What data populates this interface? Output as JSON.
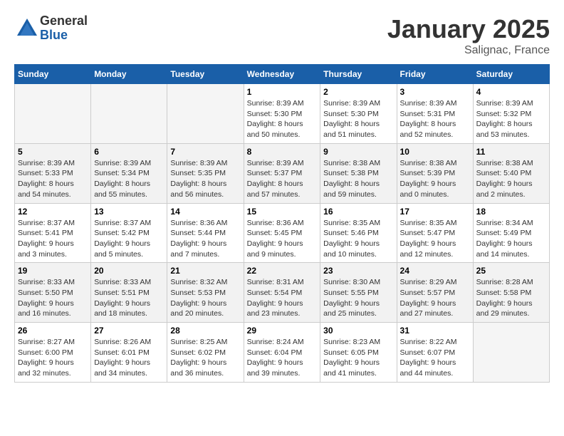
{
  "header": {
    "logo_general": "General",
    "logo_blue": "Blue",
    "month": "January 2025",
    "location": "Salignac, France"
  },
  "days_of_week": [
    "Sunday",
    "Monday",
    "Tuesday",
    "Wednesday",
    "Thursday",
    "Friday",
    "Saturday"
  ],
  "weeks": [
    [
      {
        "day": "",
        "info": ""
      },
      {
        "day": "",
        "info": ""
      },
      {
        "day": "",
        "info": ""
      },
      {
        "day": "1",
        "info": "Sunrise: 8:39 AM\nSunset: 5:30 PM\nDaylight: 8 hours\nand 50 minutes."
      },
      {
        "day": "2",
        "info": "Sunrise: 8:39 AM\nSunset: 5:30 PM\nDaylight: 8 hours\nand 51 minutes."
      },
      {
        "day": "3",
        "info": "Sunrise: 8:39 AM\nSunset: 5:31 PM\nDaylight: 8 hours\nand 52 minutes."
      },
      {
        "day": "4",
        "info": "Sunrise: 8:39 AM\nSunset: 5:32 PM\nDaylight: 8 hours\nand 53 minutes."
      }
    ],
    [
      {
        "day": "5",
        "info": "Sunrise: 8:39 AM\nSunset: 5:33 PM\nDaylight: 8 hours\nand 54 minutes."
      },
      {
        "day": "6",
        "info": "Sunrise: 8:39 AM\nSunset: 5:34 PM\nDaylight: 8 hours\nand 55 minutes."
      },
      {
        "day": "7",
        "info": "Sunrise: 8:39 AM\nSunset: 5:35 PM\nDaylight: 8 hours\nand 56 minutes."
      },
      {
        "day": "8",
        "info": "Sunrise: 8:39 AM\nSunset: 5:37 PM\nDaylight: 8 hours\nand 57 minutes."
      },
      {
        "day": "9",
        "info": "Sunrise: 8:38 AM\nSunset: 5:38 PM\nDaylight: 8 hours\nand 59 minutes."
      },
      {
        "day": "10",
        "info": "Sunrise: 8:38 AM\nSunset: 5:39 PM\nDaylight: 9 hours\nand 0 minutes."
      },
      {
        "day": "11",
        "info": "Sunrise: 8:38 AM\nSunset: 5:40 PM\nDaylight: 9 hours\nand 2 minutes."
      }
    ],
    [
      {
        "day": "12",
        "info": "Sunrise: 8:37 AM\nSunset: 5:41 PM\nDaylight: 9 hours\nand 3 minutes."
      },
      {
        "day": "13",
        "info": "Sunrise: 8:37 AM\nSunset: 5:42 PM\nDaylight: 9 hours\nand 5 minutes."
      },
      {
        "day": "14",
        "info": "Sunrise: 8:36 AM\nSunset: 5:44 PM\nDaylight: 9 hours\nand 7 minutes."
      },
      {
        "day": "15",
        "info": "Sunrise: 8:36 AM\nSunset: 5:45 PM\nDaylight: 9 hours\nand 9 minutes."
      },
      {
        "day": "16",
        "info": "Sunrise: 8:35 AM\nSunset: 5:46 PM\nDaylight: 9 hours\nand 10 minutes."
      },
      {
        "day": "17",
        "info": "Sunrise: 8:35 AM\nSunset: 5:47 PM\nDaylight: 9 hours\nand 12 minutes."
      },
      {
        "day": "18",
        "info": "Sunrise: 8:34 AM\nSunset: 5:49 PM\nDaylight: 9 hours\nand 14 minutes."
      }
    ],
    [
      {
        "day": "19",
        "info": "Sunrise: 8:33 AM\nSunset: 5:50 PM\nDaylight: 9 hours\nand 16 minutes."
      },
      {
        "day": "20",
        "info": "Sunrise: 8:33 AM\nSunset: 5:51 PM\nDaylight: 9 hours\nand 18 minutes."
      },
      {
        "day": "21",
        "info": "Sunrise: 8:32 AM\nSunset: 5:53 PM\nDaylight: 9 hours\nand 20 minutes."
      },
      {
        "day": "22",
        "info": "Sunrise: 8:31 AM\nSunset: 5:54 PM\nDaylight: 9 hours\nand 23 minutes."
      },
      {
        "day": "23",
        "info": "Sunrise: 8:30 AM\nSunset: 5:55 PM\nDaylight: 9 hours\nand 25 minutes."
      },
      {
        "day": "24",
        "info": "Sunrise: 8:29 AM\nSunset: 5:57 PM\nDaylight: 9 hours\nand 27 minutes."
      },
      {
        "day": "25",
        "info": "Sunrise: 8:28 AM\nSunset: 5:58 PM\nDaylight: 9 hours\nand 29 minutes."
      }
    ],
    [
      {
        "day": "26",
        "info": "Sunrise: 8:27 AM\nSunset: 6:00 PM\nDaylight: 9 hours\nand 32 minutes."
      },
      {
        "day": "27",
        "info": "Sunrise: 8:26 AM\nSunset: 6:01 PM\nDaylight: 9 hours\nand 34 minutes."
      },
      {
        "day": "28",
        "info": "Sunrise: 8:25 AM\nSunset: 6:02 PM\nDaylight: 9 hours\nand 36 minutes."
      },
      {
        "day": "29",
        "info": "Sunrise: 8:24 AM\nSunset: 6:04 PM\nDaylight: 9 hours\nand 39 minutes."
      },
      {
        "day": "30",
        "info": "Sunrise: 8:23 AM\nSunset: 6:05 PM\nDaylight: 9 hours\nand 41 minutes."
      },
      {
        "day": "31",
        "info": "Sunrise: 8:22 AM\nSunset: 6:07 PM\nDaylight: 9 hours\nand 44 minutes."
      },
      {
        "day": "",
        "info": ""
      }
    ]
  ]
}
